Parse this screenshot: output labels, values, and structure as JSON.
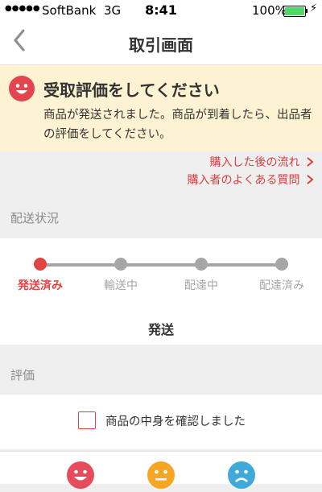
{
  "status_bar": {
    "signal": "●●●●●",
    "carrier": "SoftBank",
    "network": "3G",
    "time": "8:41",
    "battery": "100%",
    "battery_level": 1.0
  },
  "nav": {
    "back_icon": "chevron-left-icon",
    "title": "取引画面"
  },
  "notice": {
    "icon": "smile-face-icon",
    "heading": "受取評価をしてください",
    "body": "商品が発送されました。商品が到着したら、出品者の評価をしてください。"
  },
  "links": [
    {
      "label": "購入した後の流れ",
      "icon": "chevron-right-icon"
    },
    {
      "label": "購入者のよくある質問",
      "icon": "chevron-right-icon"
    }
  ],
  "shipping": {
    "section_label": "配送状況",
    "steps": [
      {
        "label": "発送済み",
        "active": true
      },
      {
        "label": "輸送中",
        "active": false
      },
      {
        "label": "配達中",
        "active": false
      },
      {
        "label": "配達済み",
        "active": false
      }
    ],
    "current_status": "発送"
  },
  "evaluation": {
    "section_label": "評価",
    "checkbox_label": "商品の中身を確認しました",
    "checked": false,
    "ratings": [
      {
        "icon": "good-face-icon",
        "color": "#e84c5a"
      },
      {
        "icon": "normal-face-icon",
        "color": "#f5a623"
      },
      {
        "icon": "bad-face-icon",
        "color": "#3fa9d8"
      }
    ]
  },
  "colors": {
    "accent": "#e24444",
    "notice_bg": "#fdf3d3",
    "battery_green": "#4cd964"
  }
}
